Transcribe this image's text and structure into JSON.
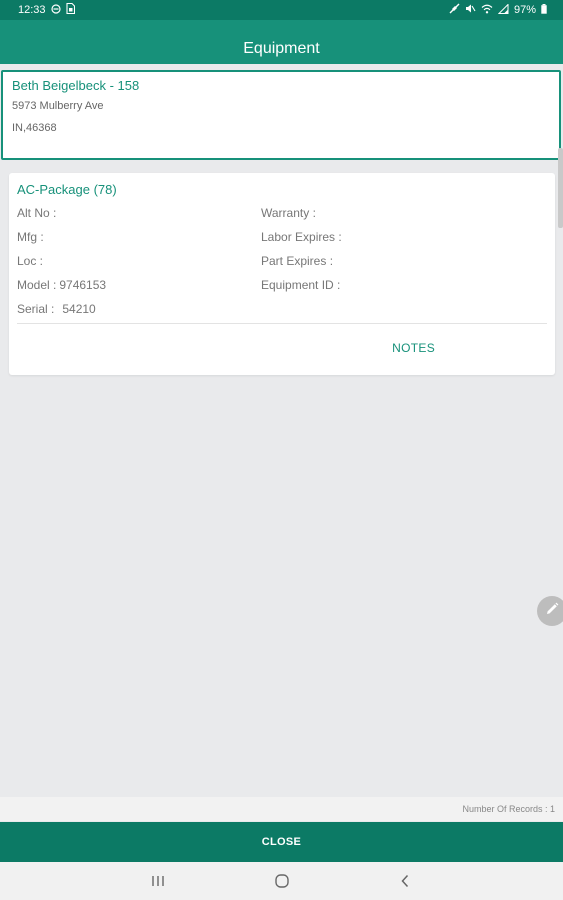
{
  "status_bar": {
    "time": "12:33",
    "battery": "97%",
    "left_icons": [
      "minus-circle-icon",
      "sim-icon"
    ],
    "right_icons": [
      "no-sound-icon",
      "mute-icon",
      "wifi-icon",
      "signal-icon",
      "battery-icon"
    ]
  },
  "header": {
    "title": "Equipment"
  },
  "customer": {
    "name": "Beth Beigelbeck - 158",
    "address": "5973 Mulberry Ave",
    "state_zip": "IN,46368"
  },
  "equipment": {
    "title": "AC-Package (78)",
    "left_fields": [
      {
        "label": "Alt No :",
        "value": ""
      },
      {
        "label": "Mfg :",
        "value": ""
      },
      {
        "label": "Loc :",
        "value": ""
      },
      {
        "label": "Model :",
        "value": "9746153"
      },
      {
        "label": "Serial :",
        "value": "54210"
      }
    ],
    "right_fields": [
      {
        "label": "Warranty :",
        "value": ""
      },
      {
        "label": "Labor Expires :",
        "value": ""
      },
      {
        "label": "Part Expires :",
        "value": ""
      },
      {
        "label": "Equipment ID :",
        "value": ""
      }
    ],
    "notes_label": "NOTES"
  },
  "footer": {
    "records_label": "Number Of Records : 1",
    "close_label": "CLOSE"
  },
  "nav": {
    "icons": [
      "recent-apps-icon",
      "home-icon",
      "back-icon"
    ]
  },
  "colors": {
    "primary": "#17917a",
    "primary_dark": "#0c7a65",
    "background": "#e9eaec"
  }
}
